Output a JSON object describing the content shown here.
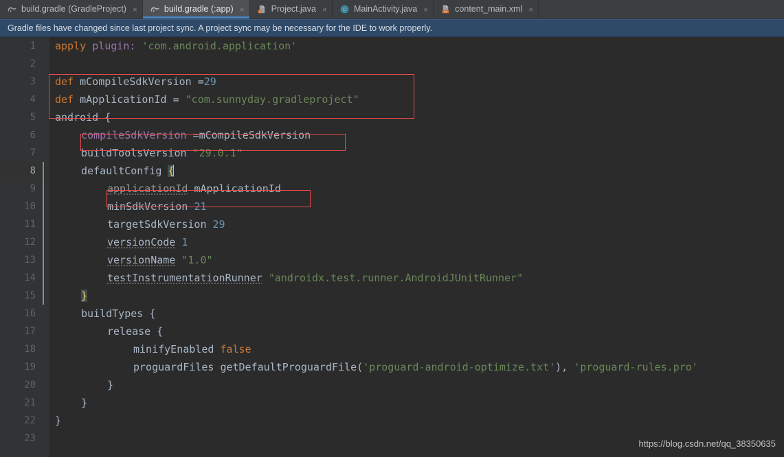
{
  "tabs": [
    {
      "label": "build.gradle (GradleProject)",
      "icon": "gradle-elephant-icon",
      "active": false,
      "close": "×"
    },
    {
      "label": "build.gradle (:app)",
      "icon": "gradle-elephant-icon",
      "active": true,
      "close": "×"
    },
    {
      "label": "Project.java",
      "icon": "java-class-icon",
      "active": false,
      "close": "×"
    },
    {
      "label": "MainActivity.java",
      "icon": "java-activity-icon",
      "active": false,
      "close": "×"
    },
    {
      "label": "content_main.xml",
      "icon": "xml-layout-icon",
      "active": false,
      "close": "×"
    }
  ],
  "notification": {
    "message": "Gradle files have changed since last project sync. A project sync may be necessary for the IDE to work properly."
  },
  "editor": {
    "filename": "build.gradle (:app)",
    "current_line": 8,
    "line_numbers": [
      1,
      2,
      3,
      4,
      5,
      6,
      7,
      8,
      9,
      10,
      11,
      12,
      13,
      14,
      15,
      16,
      17,
      18,
      19,
      20,
      21,
      22,
      23
    ],
    "lines": {
      "l1_apply": "apply",
      "l1_plugin": "plugin:",
      "l1_value": "'com.android.application'",
      "l3_def": "def",
      "l3_name": "mCompileSdkVersion",
      "l3_eq": "=",
      "l3_num": "29",
      "l4_def": "def",
      "l4_name": "mApplicationId",
      "l4_eq": "=",
      "l4_str": "\"com.sunnyday.gradleproject\"",
      "l5": "android {",
      "l6_prop": "compileSdkVersion",
      "l6_eq": "=",
      "l6_val": "mCompileSdkVersion",
      "l7_prop": "buildToolsVersion",
      "l7_str": "\"29.0.1\"",
      "l8_prop": "defaultConfig",
      "l8_brace": "{",
      "l9_prop": "applicationId",
      "l9_val": "mApplicationId",
      "l10_prop": "minSdkVersion",
      "l10_num": "21",
      "l11_prop": "targetSdkVersion",
      "l11_num": "29",
      "l12_prop": "versionCode",
      "l12_num": "1",
      "l13_prop": "versionName",
      "l13_str": "\"1.0\"",
      "l14_prop": "testInstrumentationRunner",
      "l14_str": "\"androidx.test.runner.AndroidJUnitRunner\"",
      "l15_brace": "}",
      "l16": "buildTypes {",
      "l17": "release {",
      "l18_prop": "minifyEnabled",
      "l18_kw": "false",
      "l19_prop": "proguardFiles",
      "l19_fn": "getDefaultProguardFile(",
      "l19_str1": "'proguard-android-optimize.txt'",
      "l19_mid": "), ",
      "l19_str2": "'proguard-rules.pro'",
      "l20_brace": "}",
      "l21_brace": "}",
      "l22_brace": "}"
    }
  },
  "annotations": {
    "boxes": [
      {
        "name": "def-variables-box",
        "label": "def mCompileSdkVersion / def mApplicationId"
      },
      {
        "name": "compile-sdk-version-box",
        "label": "compileSdkVersion =mCompileSdkVersion"
      },
      {
        "name": "application-id-box",
        "label": "applicationId mApplicationId"
      }
    ],
    "accent_color": "#e84a4a"
  },
  "watermark": {
    "text": "https://blog.csdn.net/qq_38350635"
  },
  "colors": {
    "tabbar_bg": "#3c3f41",
    "active_tab_bg": "#4e5254",
    "active_tab_underline": "#4a88c7",
    "notification_bg": "#2f4a69",
    "editor_bg": "#2b2b2b",
    "gutter_bg": "#313335",
    "current_line_bg": "#323232",
    "keyword": "#cc7832",
    "string": "#6a8759",
    "number": "#6897bb",
    "property": "#9876aa",
    "text": "#a9b7c6",
    "change_stripe": "#6c9a8f"
  }
}
